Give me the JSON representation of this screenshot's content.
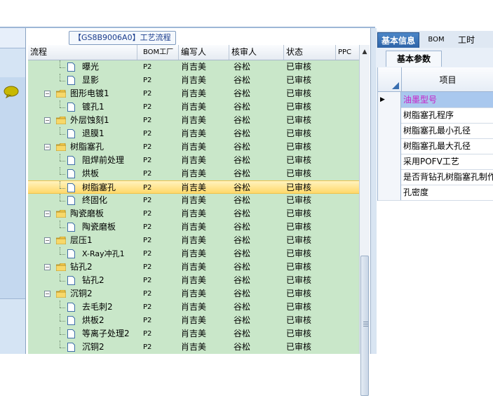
{
  "process_title": "【GS8B9006A0】工艺流程",
  "columns": [
    "流程",
    "BOM工厂",
    "编写人",
    "核审人",
    "状态",
    "PPC"
  ],
  "rows": [
    {
      "name": "曝光",
      "kind": "doc",
      "level": 2,
      "bom": "P2",
      "author": "肖吉美",
      "reviewer": "谷松",
      "status": "已审核"
    },
    {
      "name": "显影",
      "kind": "doc",
      "level": 2,
      "bom": "P2",
      "author": "肖吉美",
      "reviewer": "谷松",
      "status": "已审核"
    },
    {
      "name": "图形电镀1",
      "kind": "folder",
      "level": 1,
      "bom": "P2",
      "author": "肖吉美",
      "reviewer": "谷松",
      "status": "已审核"
    },
    {
      "name": "镀孔1",
      "kind": "doc",
      "level": 2,
      "bom": "P2",
      "author": "肖吉美",
      "reviewer": "谷松",
      "status": "已审核"
    },
    {
      "name": "外层蚀刻1",
      "kind": "folder",
      "level": 1,
      "bom": "P2",
      "author": "肖吉美",
      "reviewer": "谷松",
      "status": "已审核"
    },
    {
      "name": "退膜1",
      "kind": "doc",
      "level": 2,
      "bom": "P2",
      "author": "肖吉美",
      "reviewer": "谷松",
      "status": "已审核"
    },
    {
      "name": "树脂塞孔",
      "kind": "folder",
      "level": 1,
      "bom": "P2",
      "author": "肖吉美",
      "reviewer": "谷松",
      "status": "已审核"
    },
    {
      "name": "阻焊前处理",
      "kind": "doc",
      "level": 2,
      "bom": "P2",
      "author": "肖吉美",
      "reviewer": "谷松",
      "status": "已审核"
    },
    {
      "name": "烘板",
      "kind": "doc",
      "level": 2,
      "bom": "P2",
      "author": "肖吉美",
      "reviewer": "谷松",
      "status": "已审核"
    },
    {
      "name": "树脂塞孔",
      "kind": "doc",
      "level": 2,
      "bom": "P2",
      "author": "肖吉美",
      "reviewer": "谷松",
      "status": "已审核",
      "selected": true
    },
    {
      "name": "终固化",
      "kind": "doc",
      "level": 2,
      "bom": "P2",
      "author": "肖吉美",
      "reviewer": "谷松",
      "status": "已审核"
    },
    {
      "name": "陶瓷磨板",
      "kind": "folder",
      "level": 1,
      "bom": "P2",
      "author": "肖吉美",
      "reviewer": "谷松",
      "status": "已审核"
    },
    {
      "name": "陶瓷磨板",
      "kind": "doc",
      "level": 2,
      "bom": "P2",
      "author": "肖吉美",
      "reviewer": "谷松",
      "status": "已审核"
    },
    {
      "name": "层压1",
      "kind": "folder",
      "level": 1,
      "bom": "P2",
      "author": "肖吉美",
      "reviewer": "谷松",
      "status": "已审核"
    },
    {
      "name": "X-Ray冲孔1",
      "kind": "doc",
      "level": 2,
      "bom": "P2",
      "author": "肖吉美",
      "reviewer": "谷松",
      "status": "已审核"
    },
    {
      "name": "钻孔2",
      "kind": "folder",
      "level": 1,
      "bom": "P2",
      "author": "肖吉美",
      "reviewer": "谷松",
      "status": "已审核"
    },
    {
      "name": "钻孔2",
      "kind": "doc",
      "level": 2,
      "bom": "P2",
      "author": "肖吉美",
      "reviewer": "谷松",
      "status": "已审核"
    },
    {
      "name": "沉铜2",
      "kind": "folder",
      "level": 1,
      "bom": "P2",
      "author": "肖吉美",
      "reviewer": "谷松",
      "status": "已审核"
    },
    {
      "name": "去毛刺2",
      "kind": "doc",
      "level": 2,
      "bom": "P2",
      "author": "肖吉美",
      "reviewer": "谷松",
      "status": "已审核"
    },
    {
      "name": "烘板2",
      "kind": "doc",
      "level": 2,
      "bom": "P2",
      "author": "肖吉美",
      "reviewer": "谷松",
      "status": "已审核"
    },
    {
      "name": "等离子处理2",
      "kind": "doc",
      "level": 2,
      "bom": "P2",
      "author": "肖吉美",
      "reviewer": "谷松",
      "status": "已审核"
    },
    {
      "name": "沉铜2",
      "kind": "doc",
      "level": 2,
      "bom": "P2",
      "author": "肖吉美",
      "reviewer": "谷松",
      "status": "已审核"
    }
  ],
  "right_panel": {
    "tabs": [
      "基本信息",
      "BOM",
      "工时"
    ],
    "subtab": "基本参数",
    "column_header": "项目",
    "items": [
      {
        "label": "油墨型号",
        "selected": true
      },
      {
        "label": "树脂塞孔程序"
      },
      {
        "label": "树脂塞孔最小孔径"
      },
      {
        "label": "树脂塞孔最大孔径"
      },
      {
        "label": "采用POFV工艺"
      },
      {
        "label": "是否背钻孔树脂塞孔制作"
      },
      {
        "label": "孔密度"
      }
    ]
  },
  "colors": {
    "row_bg": "#c9e7c9",
    "selected_row": "#ffd86a",
    "tab_active": "#2e64a8",
    "highlight_text": "#c81ec8"
  }
}
